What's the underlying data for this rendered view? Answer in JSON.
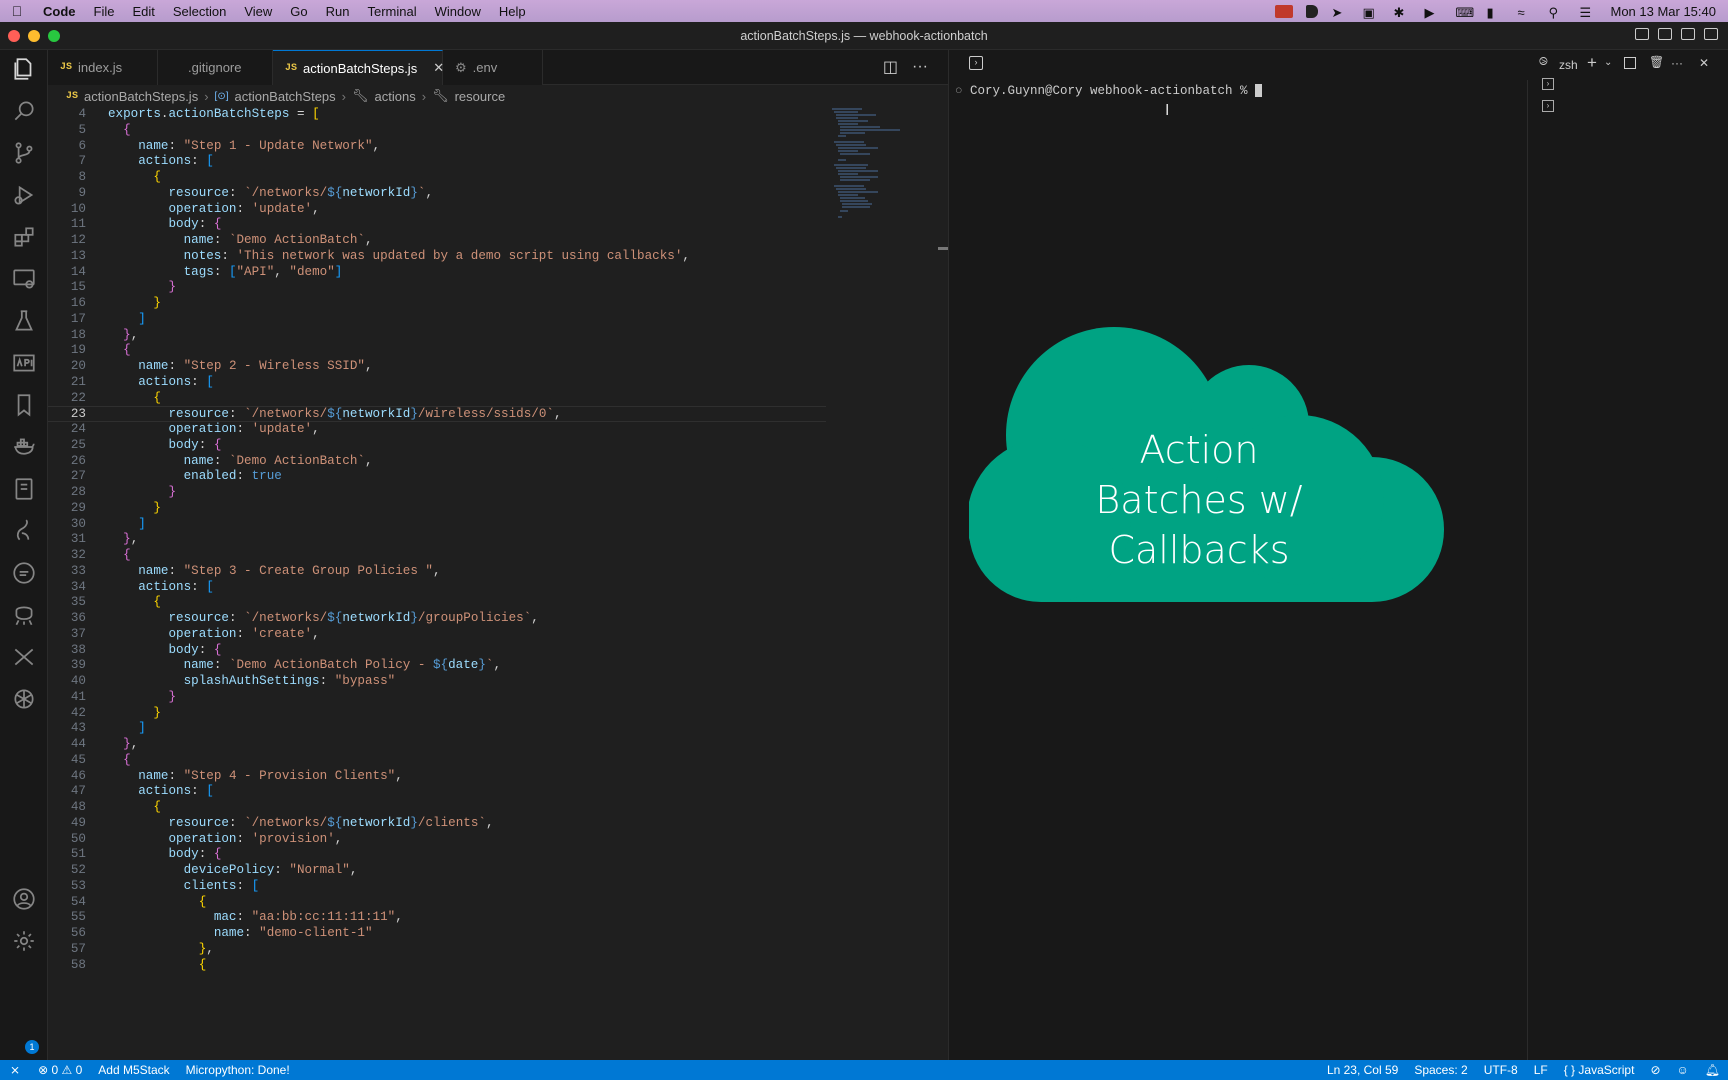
{
  "menubar": {
    "app": "Code",
    "items": [
      "File",
      "Edit",
      "Selection",
      "View",
      "Go",
      "Run",
      "Terminal",
      "Window",
      "Help"
    ],
    "datetime": "Mon 13 Mar  15:40"
  },
  "window": {
    "title": "actionBatchSteps.js — webhook-actionbatch"
  },
  "tabs": [
    {
      "label": "index.js",
      "icon": "js"
    },
    {
      "label": ".gitignore",
      "icon": "none"
    },
    {
      "label": "actionBatchSteps.js",
      "icon": "js",
      "active": true
    },
    {
      "label": ".env",
      "icon": "gear"
    }
  ],
  "breadcrumb": {
    "file": "actionBatchSteps.js",
    "symbol": "actionBatchSteps",
    "actions": "actions",
    "resource": "resource"
  },
  "editor": {
    "current_line": 23,
    "lines": [
      {
        "n": 4,
        "html": "<span class='p'>exports</span>.<span class='p'>actionBatchSteps</span> = <span class='b1'>[</span>"
      },
      {
        "n": 5,
        "html": "  <span class='b2'>{</span>"
      },
      {
        "n": 6,
        "html": "    <span class='p'>name</span>: <span class='s'>\"Step 1 - Update Network\"</span>,"
      },
      {
        "n": 7,
        "html": "    <span class='p'>actions</span>: <span class='b3'>[</span>"
      },
      {
        "n": 8,
        "html": "      <span class='b1'>{</span>"
      },
      {
        "n": 9,
        "html": "        <span class='p'>resource</span>: <span class='s'>`/networks/</span><span class='k'>${</span><span class='p'>networkId</span><span class='k'>}</span><span class='s'>`</span>,"
      },
      {
        "n": 10,
        "html": "        <span class='p'>operation</span>: <span class='s'>'update'</span>,"
      },
      {
        "n": 11,
        "html": "        <span class='p'>body</span>: <span class='b2'>{</span>"
      },
      {
        "n": 12,
        "html": "          <span class='p'>name</span>: <span class='s'>`Demo ActionBatch`</span>,"
      },
      {
        "n": 13,
        "html": "          <span class='p'>notes</span>: <span class='s'>'This network was updated by a demo script using callbacks'</span>,"
      },
      {
        "n": 14,
        "html": "          <span class='p'>tags</span>: <span class='b3'>[</span><span class='s'>\"API\"</span>, <span class='s'>\"demo\"</span><span class='b3'>]</span>"
      },
      {
        "n": 15,
        "html": "        <span class='b2'>}</span>"
      },
      {
        "n": 16,
        "html": "      <span class='b1'>}</span>"
      },
      {
        "n": 17,
        "html": "    <span class='b3'>]</span>"
      },
      {
        "n": 18,
        "html": "  <span class='b2'>}</span>,"
      },
      {
        "n": 19,
        "html": "  <span class='b2'>{</span>"
      },
      {
        "n": 20,
        "html": "    <span class='p'>name</span>: <span class='s'>\"Step 2 - Wireless SSID\"</span>,"
      },
      {
        "n": 21,
        "html": "    <span class='p'>actions</span>: <span class='b3'>[</span>"
      },
      {
        "n": 22,
        "html": "      <span class='b1'>{</span>"
      },
      {
        "n": 23,
        "html": "        <span class='p'>resource</span>: <span class='s'>`/networks/</span><span class='k'>${</span><span class='p'>networkId</span><span class='k'>}</span><span class='s'>/wireless/ssids/0`</span>,"
      },
      {
        "n": 24,
        "html": "        <span class='p'>operation</span>: <span class='s'>'update'</span>,"
      },
      {
        "n": 25,
        "html": "        <span class='p'>body</span>: <span class='b2'>{</span>"
      },
      {
        "n": 26,
        "html": "          <span class='p'>name</span>: <span class='s'>`Demo ActionBatch`</span>,"
      },
      {
        "n": 27,
        "html": "          <span class='p'>enabled</span>: <span class='k'>true</span>"
      },
      {
        "n": 28,
        "html": "        <span class='b2'>}</span>"
      },
      {
        "n": 29,
        "html": "      <span class='b1'>}</span>"
      },
      {
        "n": 30,
        "html": "    <span class='b3'>]</span>"
      },
      {
        "n": 31,
        "html": "  <span class='b2'>}</span>,"
      },
      {
        "n": 32,
        "html": "  <span class='b2'>{</span>"
      },
      {
        "n": 33,
        "html": "    <span class='p'>name</span>: <span class='s'>\"Step 3 - Create Group Policies \"</span>,"
      },
      {
        "n": 34,
        "html": "    <span class='p'>actions</span>: <span class='b3'>[</span>"
      },
      {
        "n": 35,
        "html": "      <span class='b1'>{</span>"
      },
      {
        "n": 36,
        "html": "        <span class='p'>resource</span>: <span class='s'>`/networks/</span><span class='k'>${</span><span class='p'>networkId</span><span class='k'>}</span><span class='s'>/groupPolicies`</span>,"
      },
      {
        "n": 37,
        "html": "        <span class='p'>operation</span>: <span class='s'>'create'</span>,"
      },
      {
        "n": 38,
        "html": "        <span class='p'>body</span>: <span class='b2'>{</span>"
      },
      {
        "n": 39,
        "html": "          <span class='p'>name</span>: <span class='s'>`Demo ActionBatch Policy - </span><span class='k'>${</span><span class='p'>date</span><span class='k'>}</span><span class='s'>`</span>,"
      },
      {
        "n": 40,
        "html": "          <span class='p'>splashAuthSettings</span>: <span class='s'>\"bypass\"</span>"
      },
      {
        "n": 41,
        "html": "        <span class='b2'>}</span>"
      },
      {
        "n": 42,
        "html": "      <span class='b1'>}</span>"
      },
      {
        "n": 43,
        "html": "    <span class='b3'>]</span>"
      },
      {
        "n": 44,
        "html": "  <span class='b2'>}</span>,"
      },
      {
        "n": 45,
        "html": "  <span class='b2'>{</span>"
      },
      {
        "n": 46,
        "html": "    <span class='p'>name</span>: <span class='s'>\"Step 4 - Provision Clients\"</span>,"
      },
      {
        "n": 47,
        "html": "    <span class='p'>actions</span>: <span class='b3'>[</span>"
      },
      {
        "n": 48,
        "html": "      <span class='b1'>{</span>"
      },
      {
        "n": 49,
        "html": "        <span class='p'>resource</span>: <span class='s'>`/networks/</span><span class='k'>${</span><span class='p'>networkId</span><span class='k'>}</span><span class='s'>/clients`</span>,"
      },
      {
        "n": 50,
        "html": "        <span class='p'>operation</span>: <span class='s'>'provision'</span>,"
      },
      {
        "n": 51,
        "html": "        <span class='p'>body</span>: <span class='b2'>{</span>"
      },
      {
        "n": 52,
        "html": "          <span class='p'>devicePolicy</span>: <span class='s'>\"Normal\"</span>,"
      },
      {
        "n": 53,
        "html": "          <span class='p'>clients</span>: <span class='b3'>[</span>"
      },
      {
        "n": 54,
        "html": "            <span class='b1'>{</span>"
      },
      {
        "n": 55,
        "html": "              <span class='p'>mac</span>: <span class='s'>\"aa:bb:cc:11:11:11\"</span>,"
      },
      {
        "n": 56,
        "html": "              <span class='p'>name</span>: <span class='s'>\"demo-client-1\"</span>"
      },
      {
        "n": 57,
        "html": "            <span class='b1'>}</span>,"
      },
      {
        "n": 58,
        "html": "            <span class='b1'>{</span>"
      }
    ]
  },
  "terminal": {
    "shell": "zsh",
    "prompt": "Cory.Guynn@Cory webhook-actionbatch % "
  },
  "overlay": {
    "line1": "Action",
    "line2": "Batches w/",
    "line3": "Callbacks",
    "color": "#00a383"
  },
  "status": {
    "errors": "0",
    "warnings": "0",
    "add": "Add M5Stack",
    "micro": "Micropython: Done!",
    "position": "Ln 23, Col 59",
    "spaces": "Spaces: 2",
    "encoding": "UTF-8",
    "eol": "LF",
    "language": "JavaScript",
    "accent": "#0078d4"
  }
}
